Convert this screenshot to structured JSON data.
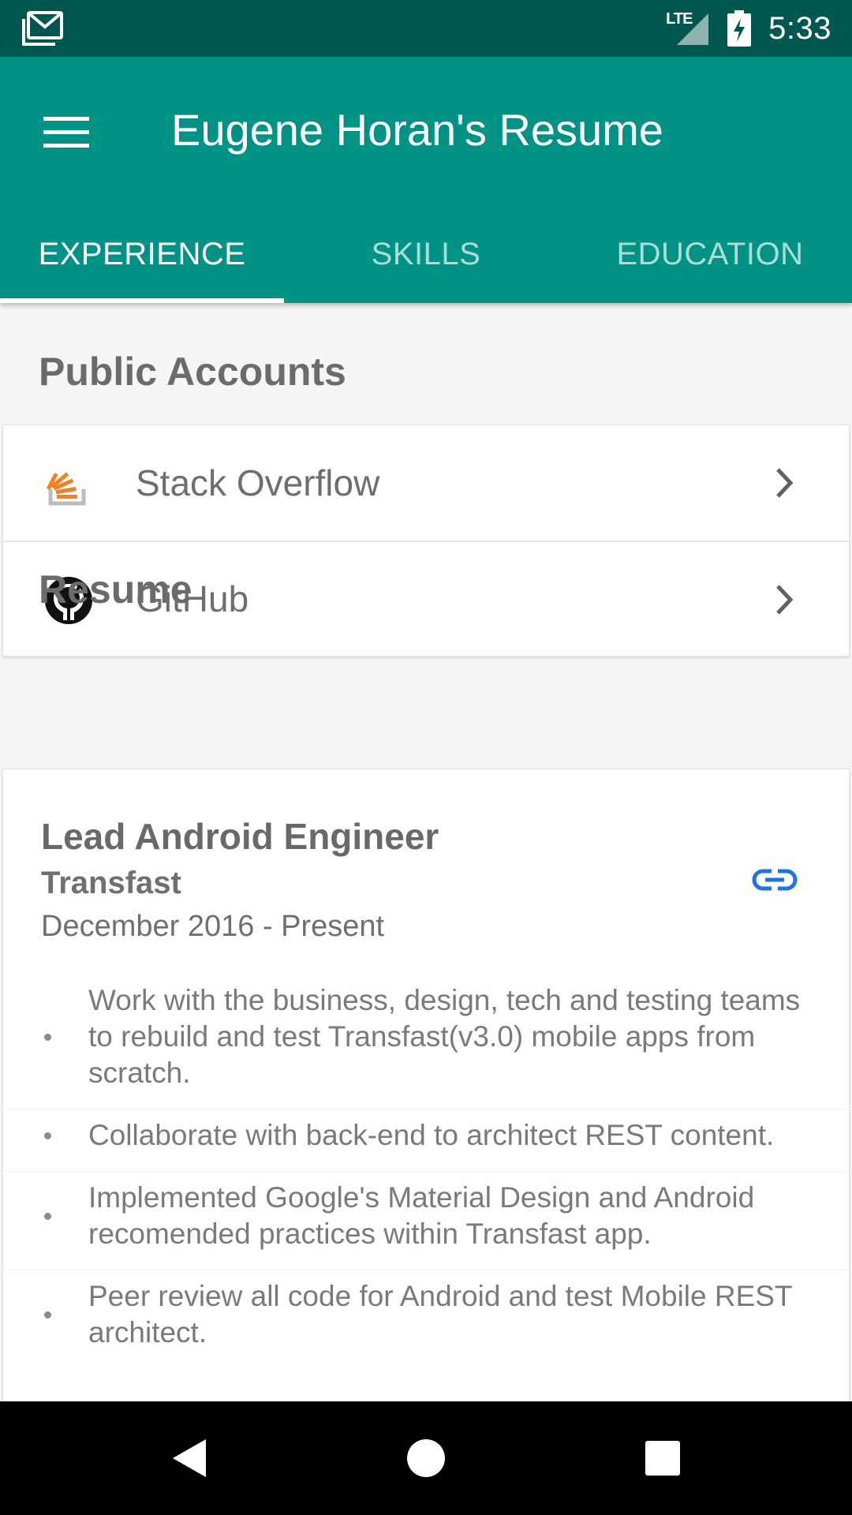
{
  "status_bar": {
    "time": "5:33",
    "network": "LTE",
    "icons": [
      "gmail-icon",
      "signal-icon",
      "battery-charging-icon"
    ]
  },
  "app_bar": {
    "title": "Eugene Horan's Resume",
    "menu_icon": "menu-icon"
  },
  "tabs": [
    {
      "label": "EXPERIENCE",
      "active": true
    },
    {
      "label": "SKILLS",
      "active": false
    },
    {
      "label": "EDUCATION",
      "active": false
    }
  ],
  "public_accounts": {
    "header": "Public Accounts",
    "items": [
      {
        "label": "Stack Overflow",
        "icon": "stack-overflow-icon"
      },
      {
        "label": "GitHub",
        "icon": "github-icon"
      }
    ]
  },
  "resume": {
    "header": "Resume",
    "jobs": [
      {
        "title": "Lead Android Engineer",
        "company": "Transfast",
        "dates": "December 2016 - Present",
        "link_icon": "link-icon",
        "bullets": [
          "Work with the business, design, tech and testing teams to rebuild and test Transfast(v3.0) mobile apps from scratch.",
          "Collaborate with back-end to architect REST content.",
          "Implemented Google's Material Design and Android recomended practices within Transfast app.",
          "Peer review all code for Android and test Mobile REST architect."
        ]
      }
    ]
  },
  "nav_bar": {
    "buttons": [
      "back-icon",
      "home-icon",
      "recents-icon"
    ]
  },
  "colors": {
    "status_bar": "#00574f",
    "primary": "#009385",
    "tab_inactive": "#a9ddd8",
    "link_accent": "#1e73e8",
    "stack_overflow_orange": "#f48024"
  }
}
